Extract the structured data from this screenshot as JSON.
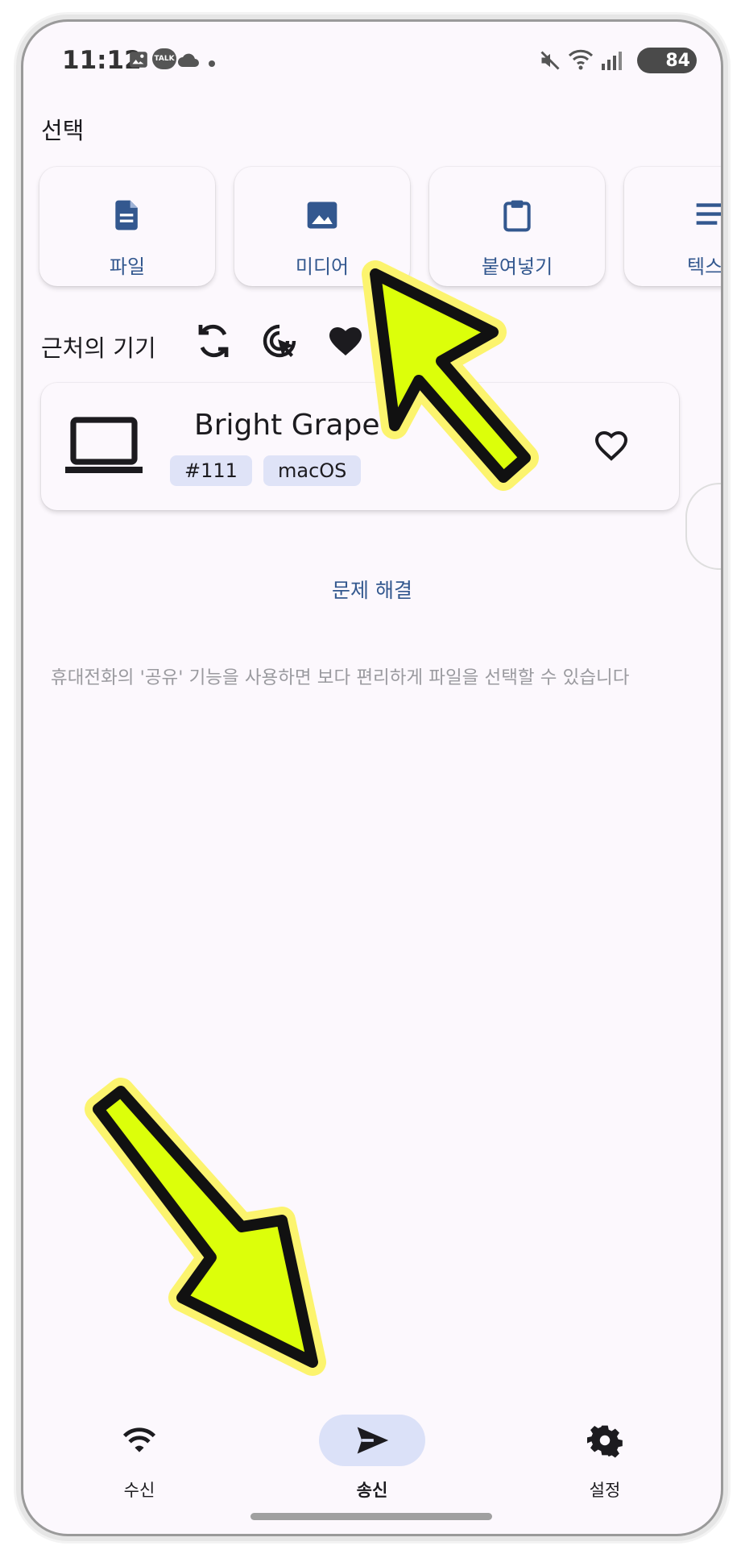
{
  "status_bar": {
    "time": "11:12",
    "talk_badge": "TALK",
    "battery": "84"
  },
  "select_section": {
    "title": "선택",
    "cards": [
      {
        "label": "파일",
        "icon": "file-icon"
      },
      {
        "label": "미디어",
        "icon": "image-icon"
      },
      {
        "label": "붙여넣기",
        "icon": "clipboard-icon"
      },
      {
        "label": "텍스",
        "icon": "text-icon"
      }
    ]
  },
  "nearby_section": {
    "title": "근처의 기기",
    "icons": [
      "refresh-icon",
      "scan-target-icon",
      "favorites-heart-icon"
    ]
  },
  "device": {
    "name": "Bright Grape",
    "chips": [
      "#111",
      "macOS"
    ],
    "icon": "laptop-icon"
  },
  "troubleshoot_label": "문제 해결",
  "hint_text": "휴대전화의 '공유' 기능을 사용하면 보다 편리하게 파일을 선택할 수 있습니다",
  "bottom_nav": [
    {
      "label": "수신",
      "icon": "wifi-icon",
      "active": false
    },
    {
      "label": "송신",
      "icon": "send-icon",
      "active": true
    },
    {
      "label": "설정",
      "icon": "gear-icon",
      "active": false
    }
  ],
  "colors": {
    "accent": "#33588f",
    "background": "#fcf8fd",
    "chip": "#dfe3f7",
    "nav_active": "#dbe1f8",
    "annotation_arrow": "#dcff0a"
  }
}
